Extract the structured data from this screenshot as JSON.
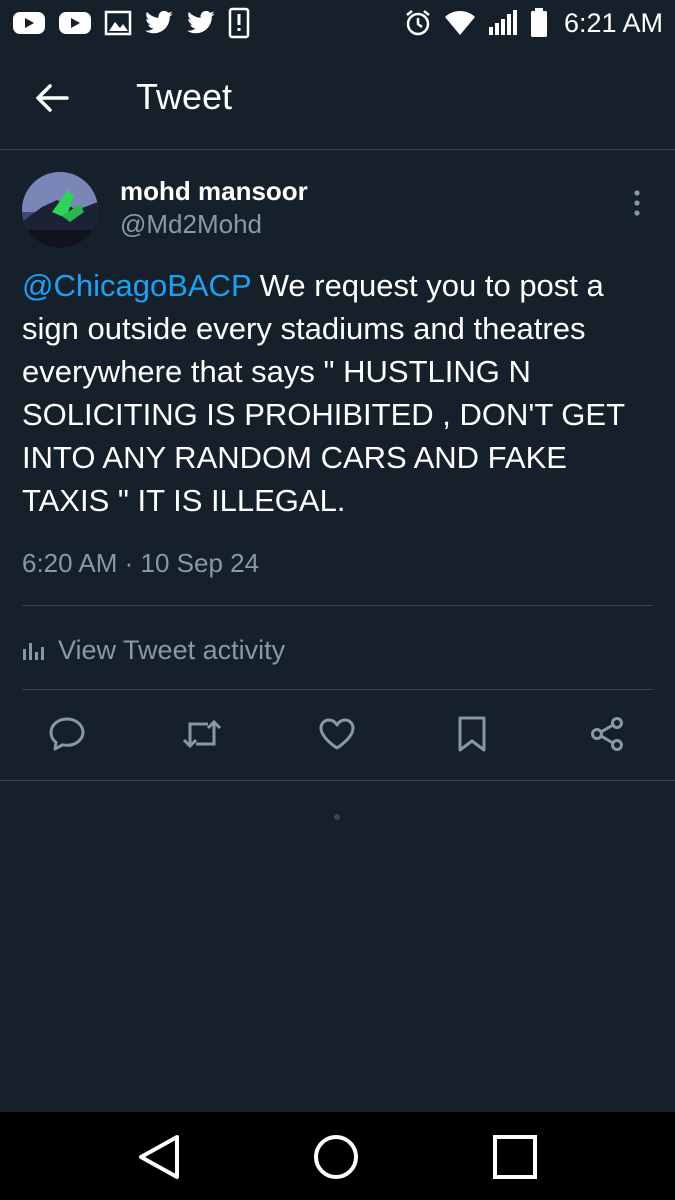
{
  "status_bar": {
    "time": "6:21 AM",
    "left_icons": [
      "youtube-icon",
      "youtube-icon",
      "image-icon",
      "twitter-icon",
      "twitter-icon",
      "alert-icon"
    ],
    "right_icons": [
      "alarm-icon",
      "wifi-icon",
      "signal-icon",
      "battery-icon"
    ]
  },
  "header": {
    "title": "Tweet"
  },
  "tweet": {
    "author_name": "mohd mansoor",
    "author_handle": "@Md2Mohd",
    "mention": "@ChicagoBACP",
    "body": " We request you to post a sign outside every stadiums and theatres everywhere that says \" HUSTLING N SOLICITING IS PROHIBITED , DON'T GET INTO ANY RANDOM CARS AND FAKE TAXIS \" IT IS ILLEGAL.",
    "timestamp": "6:20 AM · 10 Sep 24",
    "activity_label": "View Tweet activity"
  },
  "actions": [
    "reply-icon",
    "retweet-icon",
    "like-icon",
    "bookmark-icon",
    "share-icon"
  ],
  "colors": {
    "background": "#15202b",
    "accent": "#1da1f2",
    "secondary_text": "#8899a6",
    "divider": "#38444d"
  }
}
